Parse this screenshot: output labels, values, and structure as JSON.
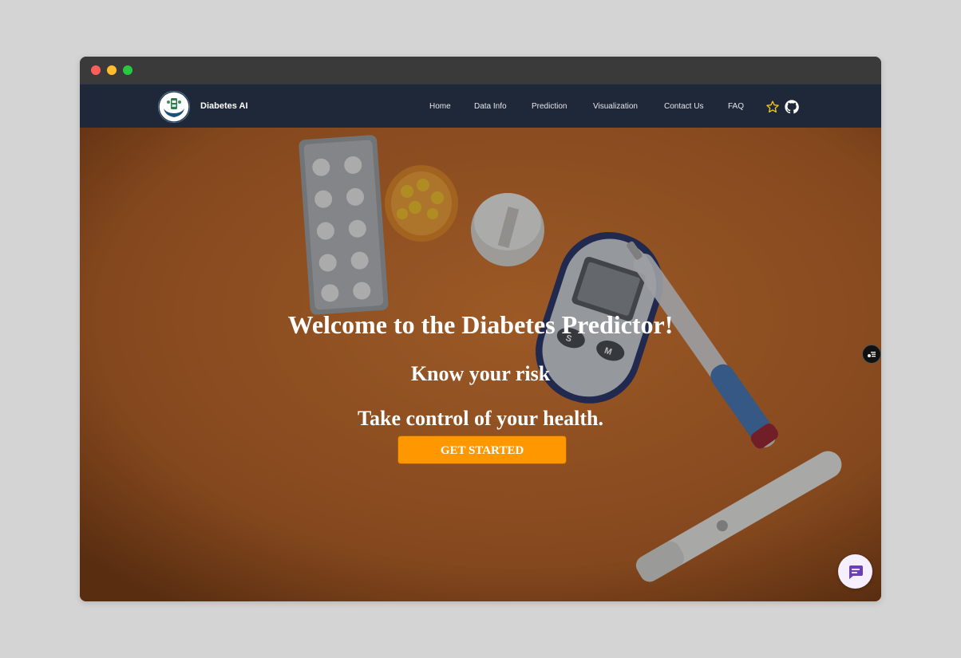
{
  "window": {
    "controls": [
      "close",
      "minimize",
      "maximize"
    ]
  },
  "navbar": {
    "brand": "Diabetes AI",
    "logo_icon": "hands-holding-medicine-logo",
    "links": [
      {
        "label": "Home"
      },
      {
        "label": "Data Info"
      },
      {
        "label": "Prediction"
      },
      {
        "label": "Visualization"
      },
      {
        "label": "Contact Us"
      },
      {
        "label": "FAQ"
      }
    ],
    "icons": [
      "star-icon",
      "github-icon"
    ]
  },
  "hero": {
    "title": "Welcome to the Diabetes Predictor!",
    "subtitle_1": "Know your risk",
    "subtitle_2": "Take control of your health.",
    "cta_label": "GET STARTED",
    "background": "pills-glucose-meter-insulin-pen-on-orange"
  },
  "colors": {
    "navbar_bg": "#1e2838",
    "hero_bg": "#c26b2c",
    "cta_bg": "#ff9800",
    "star": "#f5c518",
    "chat_icon": "#6b3fb5"
  },
  "widgets": {
    "side_widget_icon": "settings-list-icon",
    "chat_icon": "chat-bubble-icon"
  }
}
